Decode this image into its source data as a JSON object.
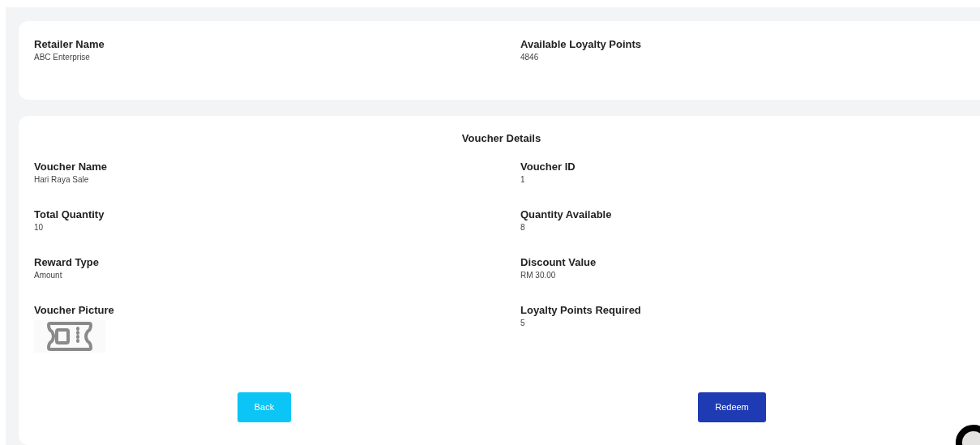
{
  "retailer": [
    {
      "label": "Retailer Name",
      "value": "ABC Enterprise"
    },
    {
      "label": "Available Loyalty Points",
      "value": "4846"
    }
  ],
  "voucher": {
    "title": "Voucher Details",
    "fields": [
      {
        "label": "Voucher Name",
        "value": "Hari Raya Sale",
        "kind": "text"
      },
      {
        "label": "Voucher ID",
        "value": "1",
        "kind": "text"
      },
      {
        "label": "Total Quantity",
        "value": "10",
        "kind": "text"
      },
      {
        "label": "Quantity Available",
        "value": "8",
        "kind": "text"
      },
      {
        "label": "Reward Type",
        "value": "Amount",
        "kind": "text"
      },
      {
        "label": "Discount Value",
        "value": "RM 30.00",
        "kind": "text"
      },
      {
        "label": "Voucher Picture",
        "kind": "picture"
      },
      {
        "label": "Loyalty Points Required",
        "value": "5",
        "kind": "text"
      }
    ]
  },
  "buttons": [
    {
      "label": "Back",
      "kind": "secondary"
    },
    {
      "label": "Redeem",
      "kind": "primary"
    }
  ]
}
